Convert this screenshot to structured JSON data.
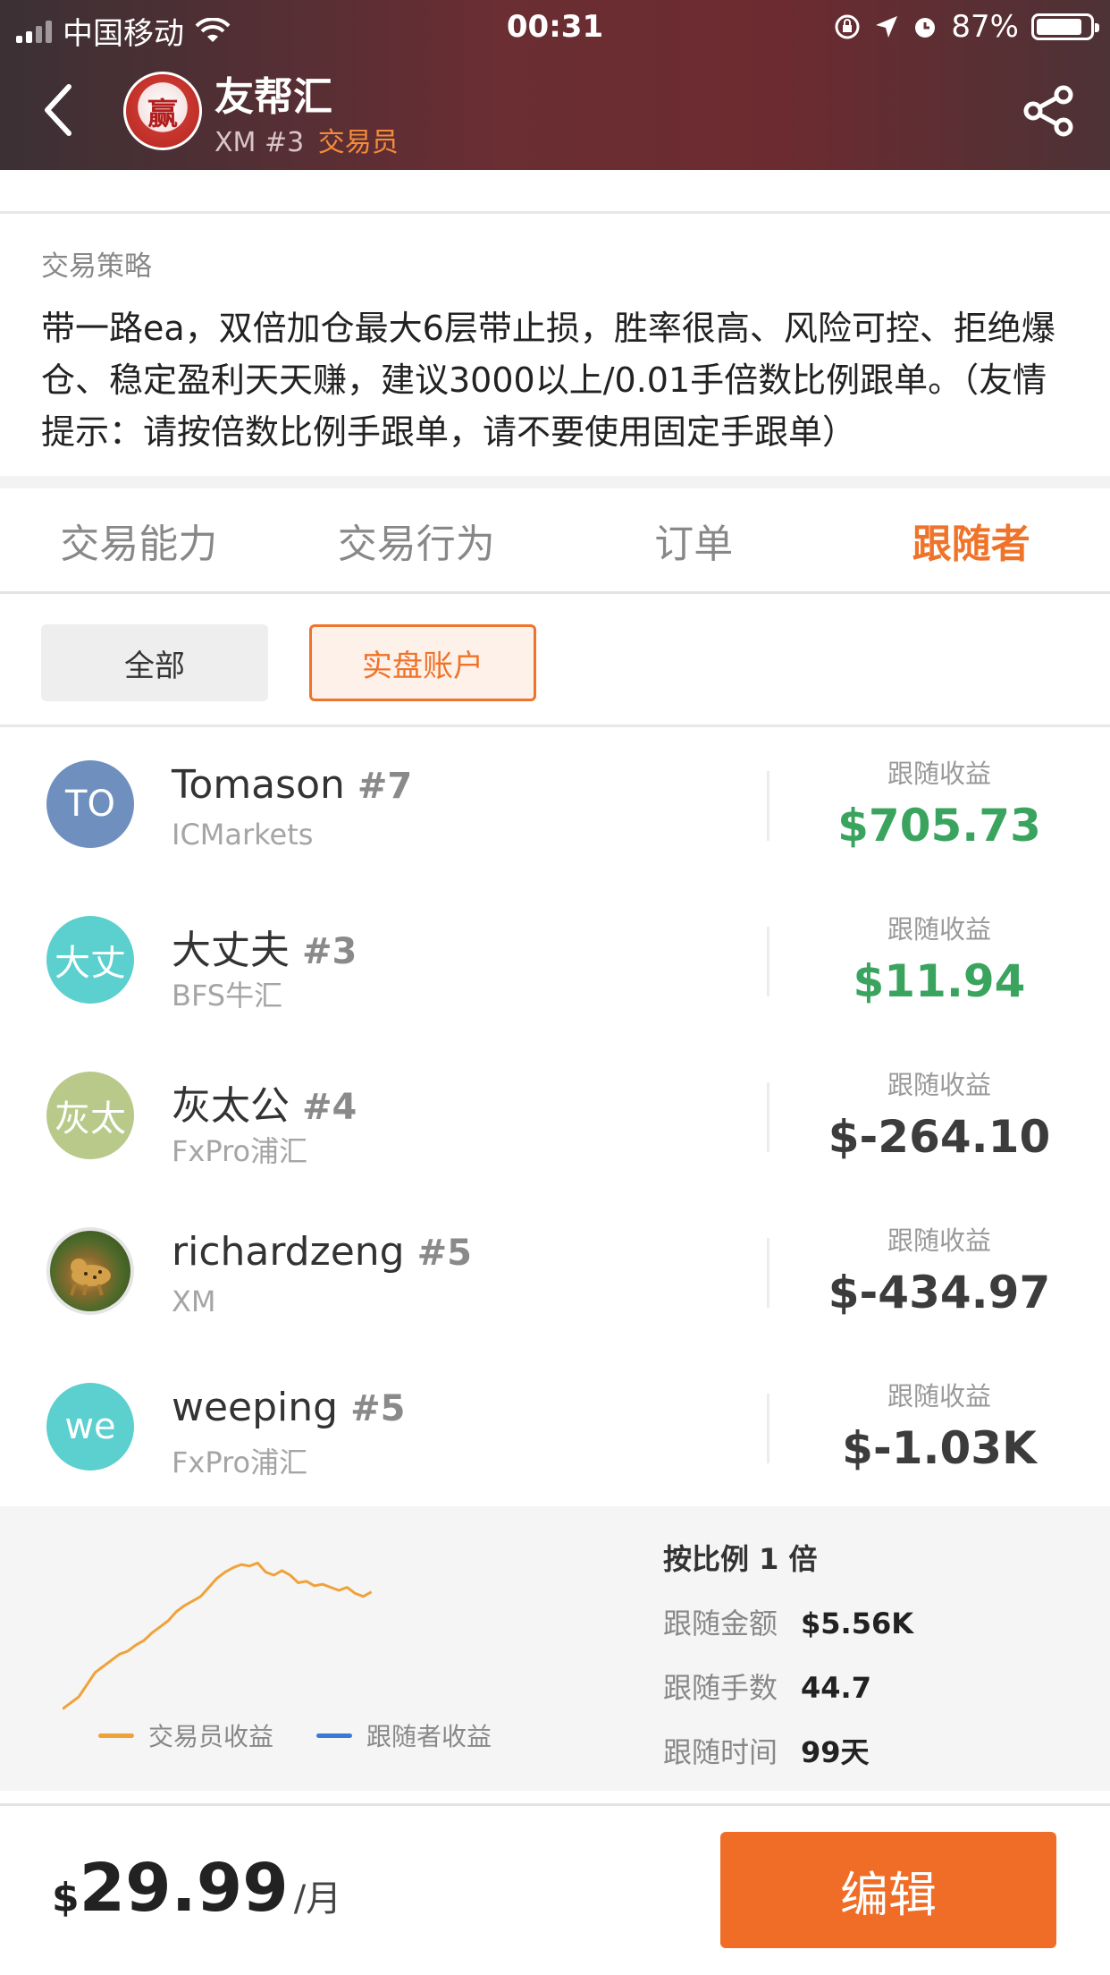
{
  "status_bar": {
    "carrier": "中国移动",
    "time": "00:31",
    "battery": "87%"
  },
  "header": {
    "title": "友帮汇",
    "broker": "XM",
    "rank": "#3",
    "role": "交易员",
    "logo_text": "赢"
  },
  "strategy": {
    "label": "交易策略",
    "text": "带一路ea，双倍加仓最大6层带止损，胜率很高、风险可控、拒绝爆仓、稳定盈利天天赚，建议3000以上/0.01手倍数比例跟单。（友情提示：请按倍数比例手跟单，请不要使用固定手跟单）"
  },
  "tabs": [
    {
      "label": "交易能力",
      "active": false
    },
    {
      "label": "交易行为",
      "active": false
    },
    {
      "label": "订单",
      "active": false
    },
    {
      "label": "跟随者",
      "active": true
    }
  ],
  "filters": [
    {
      "label": "全部",
      "selected": false
    },
    {
      "label": "实盘账户",
      "selected": true
    }
  ],
  "earnings_label": "跟随收益",
  "followers": [
    {
      "initials": "TO",
      "name": "Tomason",
      "rank": "#7",
      "broker": "ICMarkets",
      "earnings": "$705.73",
      "positive": true,
      "avatar_color": "#6f8fbf"
    },
    {
      "initials": "大丈",
      "name": "大丈夫",
      "rank": "#3",
      "broker": "BFS牛汇",
      "earnings": "$11.94",
      "positive": true,
      "avatar_color": "#5ccfcf"
    },
    {
      "initials": "灰太",
      "name": "灰太公",
      "rank": "#4",
      "broker": "FxPro浦汇",
      "earnings": "$-264.10",
      "positive": false,
      "avatar_color": "#b8c98a"
    },
    {
      "initials": "",
      "name": "richardzeng",
      "rank": "#5",
      "broker": "XM",
      "earnings": "$-434.97",
      "positive": false,
      "avatar_color": "#6a7a3a"
    },
    {
      "initials": "we",
      "name": "weeping",
      "rank": "#5",
      "broker": "FxPro浦汇",
      "earnings": "$-1.03K",
      "positive": false,
      "avatar_color": "#5ccfcf"
    }
  ],
  "summary": {
    "title": "按比例 1 倍",
    "rows": [
      {
        "label": "跟随金额",
        "value": "$5.56K"
      },
      {
        "label": "跟随手数",
        "value": "44.7"
      },
      {
        "label": "跟随时间",
        "value": "99天"
      }
    ],
    "legend": {
      "trader": "交易员收益",
      "follower": "跟随者收益",
      "trader_color": "#f0a23a",
      "follower_color": "#3a7ad6"
    }
  },
  "chart_data": {
    "type": "line",
    "title": "",
    "xlabel": "",
    "ylabel": "",
    "series": [
      {
        "name": "交易员收益",
        "values": [
          2,
          6,
          10,
          18,
          26,
          30,
          34,
          38,
          40,
          44,
          47,
          52,
          56,
          60,
          66,
          70,
          73,
          76,
          82,
          88,
          92,
          95,
          97,
          96,
          98,
          92,
          90,
          93,
          90,
          85,
          86,
          83,
          84,
          82,
          80,
          82,
          78,
          76,
          79
        ]
      },
      {
        "name": "跟随者收益",
        "values": []
      }
    ],
    "ylim": [
      0,
      100
    ]
  },
  "bottom": {
    "currency": "$",
    "price": "29.99",
    "per": "/月",
    "edit_label": "编辑"
  },
  "colors": {
    "accent": "#f0732a",
    "positive": "#3aa45f",
    "negative": "#3c3c3c"
  }
}
